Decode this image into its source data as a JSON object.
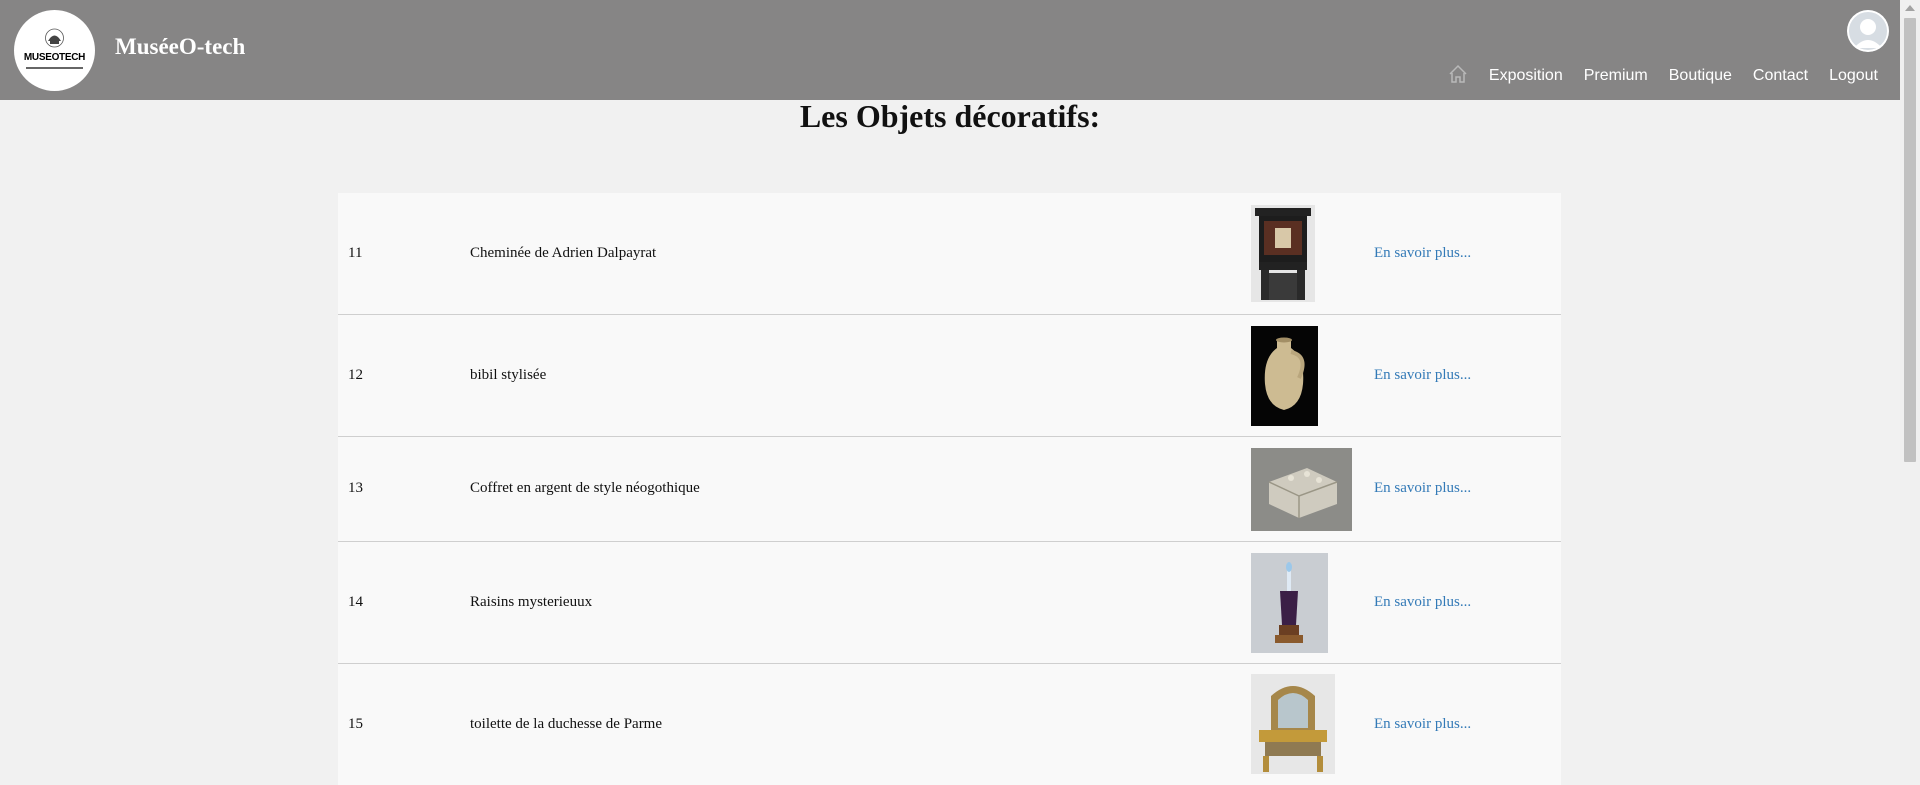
{
  "site": {
    "logo_text": "MUSEOTECH",
    "title": "MuséeO-tech"
  },
  "nav": {
    "items": [
      "Exposition",
      "Premium",
      "Boutique",
      "Contact",
      "Logout"
    ]
  },
  "page": {
    "title": "Les Objets décoratifs:"
  },
  "rows": [
    {
      "id": "11",
      "name": "Cheminée de Adrien Dalpayrat",
      "link": "En savoir plus..."
    },
    {
      "id": "12",
      "name": "bibil stylisée",
      "link": "En savoir plus..."
    },
    {
      "id": "13",
      "name": "Coffret en argent de style néogothique",
      "link": "En savoir plus..."
    },
    {
      "id": "14",
      "name": "Raisins mysterieuux",
      "link": "En savoir plus..."
    },
    {
      "id": "15",
      "name": "toilette de la duchesse de Parme",
      "link": "En savoir plus..."
    }
  ],
  "colors": {
    "header": "#868585",
    "link": "#337ab7",
    "background": "#f1f1f1"
  }
}
